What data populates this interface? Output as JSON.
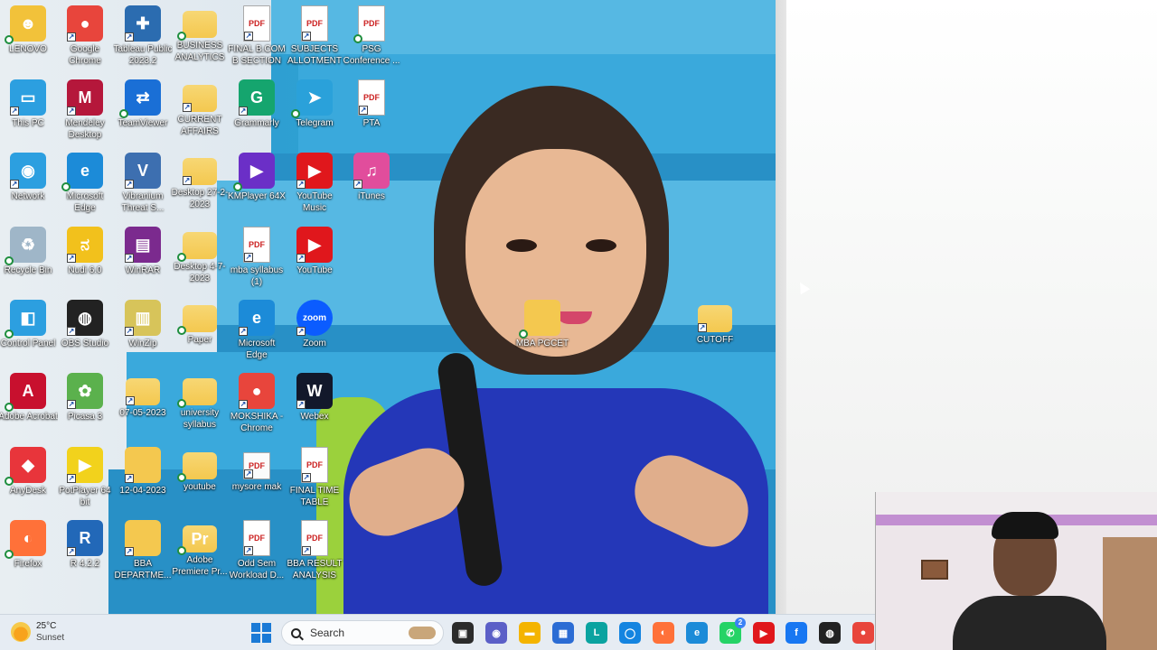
{
  "desktop": {
    "icons": [
      {
        "label": "LENOVO",
        "glyph": "☻",
        "color": "#f2c23a"
      },
      {
        "label": "Google Chrome",
        "glyph": "●",
        "color": "#e8453c"
      },
      {
        "label": "Tableau Public 2023.2",
        "glyph": "✚",
        "color": "#2b6cb0"
      },
      {
        "label": "BUSINESS ANALYTICS",
        "glyph": "",
        "color": "#f4c84f"
      },
      {
        "label": "FINAL B.COM B SECTION",
        "glyph": "PDF",
        "color": "#ffffff"
      },
      {
        "label": "SUBJECTS ALLOTMENT",
        "glyph": "PDF",
        "color": "#ffffff"
      },
      {
        "label": "PSG Conference ...",
        "glyph": "PDF",
        "color": "#ffffff"
      },
      {
        "label": "This PC",
        "glyph": "▭",
        "color": "#2c9fe0"
      },
      {
        "label": "Mendeley Desktop",
        "glyph": "M",
        "color": "#b5173b"
      },
      {
        "label": "TeamViewer",
        "glyph": "⇄",
        "color": "#1a6fd6"
      },
      {
        "label": "CURRENT AFFAIRS",
        "glyph": "",
        "color": "#f4c84f"
      },
      {
        "label": "Grammarly",
        "glyph": "G",
        "color": "#15a56e"
      },
      {
        "label": "Telegram",
        "glyph": "➤",
        "color": "#2aa1da"
      },
      {
        "label": "PTA",
        "glyph": "PDF",
        "color": "#ffffff"
      },
      {
        "label": "Network",
        "glyph": "◉",
        "color": "#2c9fe0"
      },
      {
        "label": "Microsoft Edge",
        "glyph": "e",
        "color": "#1c8bd8"
      },
      {
        "label": "Vibranium Threat S...",
        "glyph": "V",
        "color": "#3d6fb0"
      },
      {
        "label": "Desktop 27-2-2023",
        "glyph": "",
        "color": "#f4c84f"
      },
      {
        "label": "KMPlayer 64X",
        "glyph": "▶",
        "color": "#6b2fc7"
      },
      {
        "label": "YouTube Music",
        "glyph": "▶",
        "color": "#e0171c"
      },
      {
        "label": "iTunes",
        "glyph": "♫",
        "color": "#e14d9c"
      },
      {
        "label": "Recycle Bin",
        "glyph": "♻",
        "color": "#9fb6c8"
      },
      {
        "label": "Nudi 6.0",
        "glyph": "ನ",
        "color": "#f2c11c"
      },
      {
        "label": "WinRAR",
        "glyph": "▤",
        "color": "#7b2a8e"
      },
      {
        "label": "Desktop 4-7-2023",
        "glyph": "",
        "color": "#f4c84f"
      },
      {
        "label": "mba syllabus (1)",
        "glyph": "PDF",
        "color": "#ffffff"
      },
      {
        "label": "YouTube",
        "glyph": "▶",
        "color": "#e0171c"
      },
      {
        "label": "Control Panel",
        "glyph": "◧",
        "color": "#2c9fe0"
      },
      {
        "label": "OBS Studio",
        "glyph": "◍",
        "color": "#222222"
      },
      {
        "label": "WinZip",
        "glyph": "▥",
        "color": "#d7c45a"
      },
      {
        "label": "Paper",
        "glyph": "",
        "color": "#f4c84f"
      },
      {
        "label": "Microsoft Edge",
        "glyph": "e",
        "color": "#1c8bd8"
      },
      {
        "label": "Zoom",
        "glyph": "zoom",
        "color": "#0b5cff"
      },
      {
        "label": "Adobe Acrobat",
        "glyph": "A",
        "color": "#c8102e"
      },
      {
        "label": "Picasa 3",
        "glyph": "✿",
        "color": "#5bb14d"
      },
      {
        "label": "07-05-2023",
        "glyph": "",
        "color": "#f4c84f"
      },
      {
        "label": "university syllabus",
        "glyph": "",
        "color": "#f4c84f"
      },
      {
        "label": "MOKSHIKA - Chrome",
        "glyph": "●",
        "color": "#e8453c"
      },
      {
        "label": "Webex",
        "glyph": "W",
        "color": "#12182b"
      },
      {
        "label": "AnyDesk",
        "glyph": "◆",
        "color": "#e8353b"
      },
      {
        "label": "PotPlayer 64 bit",
        "glyph": "▶",
        "color": "#f2d21c"
      },
      {
        "label": "12-04-2023",
        "glyph": "",
        "color": "#f4c84f"
      },
      {
        "label": "youtube",
        "glyph": "",
        "color": "#f4c84f"
      },
      {
        "label": "mysore mak",
        "glyph": "PDF",
        "color": "#ffffff"
      },
      {
        "label": "FINAL TIME TABLE",
        "glyph": "PDF",
        "color": "#ffffff"
      },
      {
        "label": "Firefox",
        "glyph": "◐",
        "color": "#ff7139"
      },
      {
        "label": "R 4.2.2",
        "glyph": "R",
        "color": "#2268b8"
      },
      {
        "label": "BBA DEPARTME...",
        "glyph": "",
        "color": "#f4c84f"
      },
      {
        "label": "Adobe Premiere Pr...",
        "glyph": "Pr",
        "color": "#1d1446"
      },
      {
        "label": "Odd Sem Workload D...",
        "glyph": "PDF",
        "color": "#ffffff"
      },
      {
        "label": "BBA RESULT ANALYSIS",
        "glyph": "PDF",
        "color": "#ffffff"
      },
      {
        "label": "MBA PGCET",
        "glyph": "",
        "color": "#f4c84f"
      },
      {
        "label": "CUTOFF",
        "glyph": "",
        "color": "#f4c84f"
      }
    ]
  },
  "taskbar": {
    "weather_temp": "25°C",
    "weather_text": "Sunset",
    "search_label": "Search",
    "apps": [
      {
        "name": "task-view-icon",
        "glyph": "▣",
        "color": "#2b2b2b"
      },
      {
        "name": "chat-icon",
        "glyph": "◉",
        "color": "#5b5fc7"
      },
      {
        "name": "file-explorer-icon",
        "glyph": "▬",
        "color": "#f4b400"
      },
      {
        "name": "store-icon",
        "glyph": "▦",
        "color": "#2b6cd4"
      },
      {
        "name": "lens-icon",
        "glyph": "L",
        "color": "#0aa3a0"
      },
      {
        "name": "cortana-icon",
        "glyph": "◯",
        "color": "#1484e0"
      },
      {
        "name": "firefox-icon",
        "glyph": "◐",
        "color": "#ff7139"
      },
      {
        "name": "edge-icon",
        "glyph": "e",
        "color": "#1c8bd8"
      },
      {
        "name": "whatsapp-icon",
        "glyph": "✆",
        "color": "#25d366"
      },
      {
        "name": "youtube-icon",
        "glyph": "▶",
        "color": "#e0171c"
      },
      {
        "name": "facebook-icon",
        "glyph": "f",
        "color": "#1877f2"
      },
      {
        "name": "obs-icon",
        "glyph": "◍",
        "color": "#222222"
      },
      {
        "name": "chrome-icon",
        "glyph": "●",
        "color": "#e8453c"
      }
    ],
    "whatsapp_badge": "2"
  }
}
